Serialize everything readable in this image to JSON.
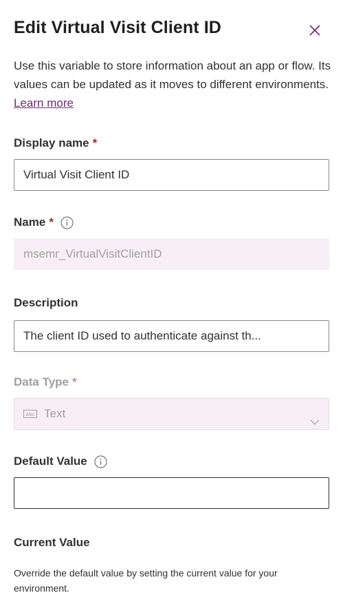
{
  "panel": {
    "title": "Edit Virtual Visit Client ID",
    "close_icon": "close-icon",
    "intro_text": "Use this variable to store information about an app or flow. Its values can be updated as it moves to different environments.",
    "learn_more": "Learn more"
  },
  "fields": {
    "display_name": {
      "label": "Display name",
      "required": "*",
      "value": "Virtual Visit Client ID"
    },
    "name": {
      "label": "Name",
      "required": "*",
      "value": "msemr_VirtualVisitClientID",
      "info_icon": "info-icon"
    },
    "description": {
      "label": "Description",
      "value": "The client ID used to authenticate against th..."
    },
    "data_type": {
      "label": "Data Type",
      "required": "*",
      "value": "Text",
      "type_icon": "text-type-icon",
      "chevron_icon": "chevron-down-icon"
    },
    "default_value": {
      "label": "Default Value",
      "value": "",
      "info_icon": "info-icon"
    }
  },
  "current_value": {
    "title": "Current Value",
    "help": "Override the default value by setting the current value for your environment."
  },
  "colors": {
    "accent": "#742774",
    "required": "#a4262c",
    "disabled_bg": "#f7eff5",
    "border": "#8a8886"
  }
}
